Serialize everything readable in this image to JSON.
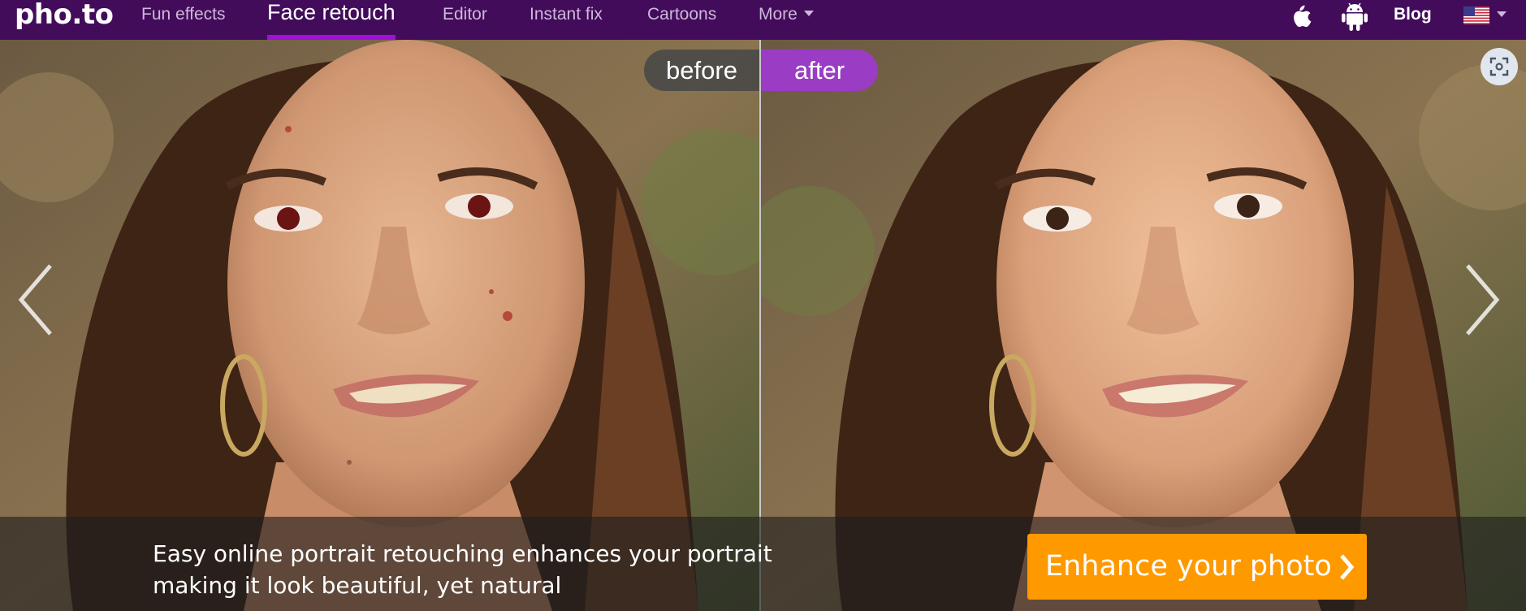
{
  "nav": {
    "logo": "pho.to",
    "items": [
      {
        "label": "Fun effects",
        "active": false
      },
      {
        "label": "Face retouch",
        "active": true
      },
      {
        "label": "Editor",
        "active": false
      },
      {
        "label": "Instant fix",
        "active": false
      },
      {
        "label": "Cartoons",
        "active": false
      },
      {
        "label": "More",
        "active": false
      }
    ],
    "icons": [
      "apple-icon",
      "android-icon"
    ],
    "blog": "Blog",
    "language_flag": "us-flag-icon"
  },
  "hero": {
    "toggle": {
      "before": "before",
      "after": "after",
      "selected": "after"
    },
    "caption": "Easy online portrait retouching enhances your portrait making it look beautiful, yet natural",
    "cta": "Enhance your photo"
  },
  "colors": {
    "nav_bg": "#430c5b",
    "active_underline": "#a20fd8",
    "toggle_after": "#9a3cc4",
    "cta": "#ff9900"
  }
}
